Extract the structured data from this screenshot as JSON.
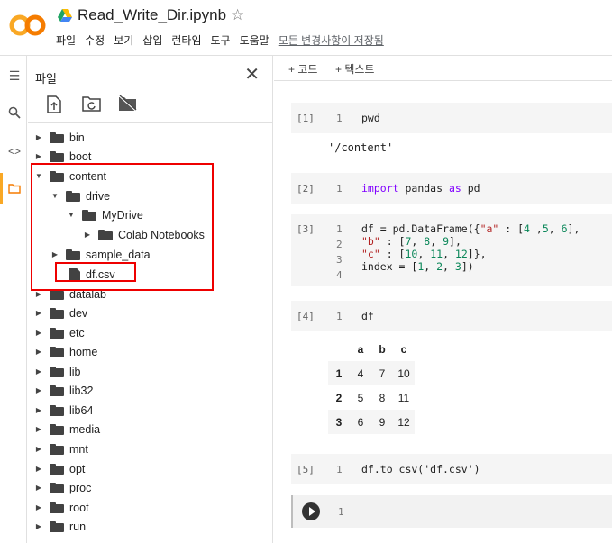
{
  "header": {
    "title": "Read_Write_Dir.ipynb",
    "menu": [
      "파일",
      "수정",
      "보기",
      "삽입",
      "런타임",
      "도구",
      "도움말"
    ],
    "save_status": "모든 변경사항이 저장됨"
  },
  "rail": {
    "icons": [
      "menu-icon",
      "search-icon",
      "code-icon",
      "folder-icon"
    ]
  },
  "files_panel": {
    "title": "파일",
    "tree": [
      {
        "label": "bin",
        "depth": 0,
        "type": "folder",
        "expanded": false
      },
      {
        "label": "boot",
        "depth": 0,
        "type": "folder",
        "expanded": false
      },
      {
        "label": "content",
        "depth": 0,
        "type": "folder",
        "expanded": true
      },
      {
        "label": "drive",
        "depth": 1,
        "type": "folder",
        "expanded": true
      },
      {
        "label": "MyDrive",
        "depth": 2,
        "type": "folder",
        "expanded": true
      },
      {
        "label": "Colab Notebooks",
        "depth": 3,
        "type": "folder",
        "expanded": false
      },
      {
        "label": "sample_data",
        "depth": 1,
        "type": "folder",
        "expanded": false
      },
      {
        "label": "df.csv",
        "depth": 1,
        "type": "file"
      },
      {
        "label": "datalab",
        "depth": 0,
        "type": "folder",
        "expanded": false
      },
      {
        "label": "dev",
        "depth": 0,
        "type": "folder",
        "expanded": false
      },
      {
        "label": "etc",
        "depth": 0,
        "type": "folder",
        "expanded": false
      },
      {
        "label": "home",
        "depth": 0,
        "type": "folder",
        "expanded": false
      },
      {
        "label": "lib",
        "depth": 0,
        "type": "folder",
        "expanded": false
      },
      {
        "label": "lib32",
        "depth": 0,
        "type": "folder",
        "expanded": false
      },
      {
        "label": "lib64",
        "depth": 0,
        "type": "folder",
        "expanded": false
      },
      {
        "label": "media",
        "depth": 0,
        "type": "folder",
        "expanded": false
      },
      {
        "label": "mnt",
        "depth": 0,
        "type": "folder",
        "expanded": false
      },
      {
        "label": "opt",
        "depth": 0,
        "type": "folder",
        "expanded": false
      },
      {
        "label": "proc",
        "depth": 0,
        "type": "folder",
        "expanded": false
      },
      {
        "label": "root",
        "depth": 0,
        "type": "folder",
        "expanded": false
      },
      {
        "label": "run",
        "depth": 0,
        "type": "folder",
        "expanded": false
      }
    ]
  },
  "toolbar": {
    "add_code": "+ 코드",
    "add_text": "+ 텍스트"
  },
  "cells": {
    "c1": {
      "prompt": "[1]",
      "line": "1",
      "code": "pwd",
      "output": "'/content'"
    },
    "c2": {
      "prompt": "[2]",
      "line": "1"
    },
    "c3": {
      "prompt": "[3]",
      "lines": [
        "1",
        "2",
        "3",
        "4"
      ]
    },
    "c4": {
      "prompt": "[4]",
      "line": "1",
      "code": "df"
    },
    "c5": {
      "prompt": "[5]",
      "line": "1",
      "code": "df.to_csv('df.csv')"
    },
    "c6": {
      "line": "1"
    }
  },
  "dataframe": {
    "columns": [
      "a",
      "b",
      "c"
    ],
    "rows": [
      {
        "index": "1",
        "a": "4",
        "b": "7",
        "c": "10"
      },
      {
        "index": "2",
        "a": "5",
        "b": "8",
        "c": "11"
      },
      {
        "index": "3",
        "a": "6",
        "b": "9",
        "c": "12"
      }
    ]
  },
  "colors": {
    "accent": "#f9a825",
    "highlight_box": "#ee0000",
    "keyword": "#8000ff"
  }
}
